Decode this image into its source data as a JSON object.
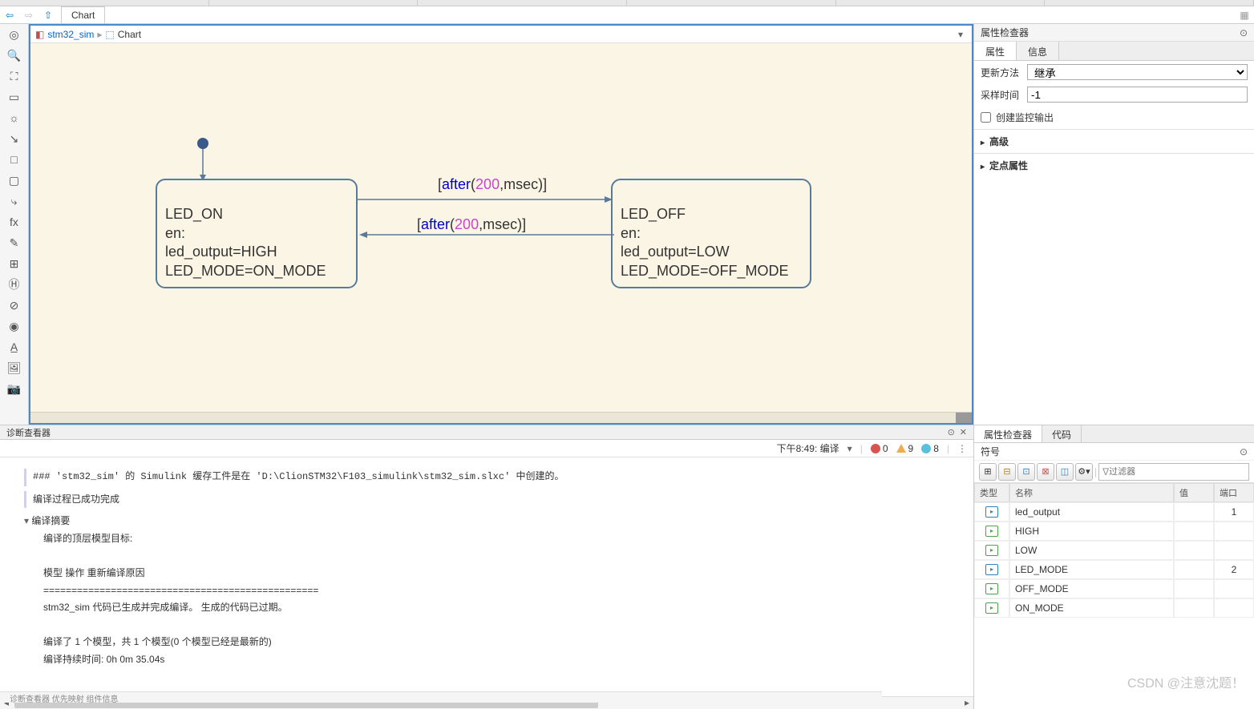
{
  "tab_title": "Chart",
  "breadcrumb": {
    "model": "stm32_sim",
    "chart": "Chart"
  },
  "states": {
    "on": {
      "name": "LED_ON",
      "en": "en:",
      "l1": "led_output=HIGH",
      "l2": "LED_MODE=ON_MODE"
    },
    "off": {
      "name": "LED_OFF",
      "en": "en:",
      "l1": "led_output=LOW",
      "l2": "LED_MODE=OFF_MODE"
    }
  },
  "transitions": {
    "t1": {
      "pre": "[",
      "kw": "after",
      "open": "(",
      "num": "200",
      "rest": ",msec)]"
    },
    "t2": {
      "pre": "[",
      "kw": "after",
      "open": "(",
      "num": "200",
      "rest": ",msec)]"
    }
  },
  "inspector": {
    "title": "属性检查器",
    "tabs": {
      "props": "属性",
      "info": "信息"
    },
    "update_label": "更新方法",
    "update_value": "继承",
    "sample_label": "采样时间",
    "sample_value": "-1",
    "cb_label": "创建监控输出",
    "adv": "高级",
    "fixed": "定点属性"
  },
  "symbols_panel": {
    "tabs": {
      "inspector": "属性检查器",
      "code": "代码"
    },
    "header": "符号",
    "filter_placeholder": "过滤器",
    "cols": {
      "type": "类型",
      "name": "名称",
      "value": "值",
      "port": "端口"
    },
    "rows": [
      {
        "name": "led_output",
        "value": "",
        "port": "1",
        "icon": "out"
      },
      {
        "name": "HIGH",
        "value": "",
        "port": "",
        "icon": "const"
      },
      {
        "name": "LOW",
        "value": "",
        "port": "",
        "icon": "const"
      },
      {
        "name": "LED_MODE",
        "value": "",
        "port": "2",
        "icon": "out"
      },
      {
        "name": "OFF_MODE",
        "value": "",
        "port": "",
        "icon": "const"
      },
      {
        "name": "ON_MODE",
        "value": "",
        "port": "",
        "icon": "const"
      }
    ]
  },
  "diag": {
    "title": "诊断查看器",
    "time": "下午8:49: 编译",
    "err": "0",
    "warn": "9",
    "info": "8",
    "line1": "### 'stm32_sim' 的 Simulink 缓存工件是在 'D:\\ClionSTM32\\F103_simulink\\stm32_sim.slxc' 中创建的。",
    "line2": "编译过程已成功完成",
    "summary": "编译摘要",
    "s1": "编译的顶层模型目标:",
    "s2h": "模型          操作              重新编译原因",
    "s2d": "=================================================",
    "s3": "stm32_sim   代码已生成并完成编译。    生成的代码已过期。",
    "s4": "编译了 1 个模型，共 1 个模型(0 个模型已经是最新的)",
    "s5": "编译持续时间: 0h 0m 35.04s"
  },
  "watermark": "CSDN @注意沈题！",
  "footer": "诊断查看器     优先映射     组件信息"
}
